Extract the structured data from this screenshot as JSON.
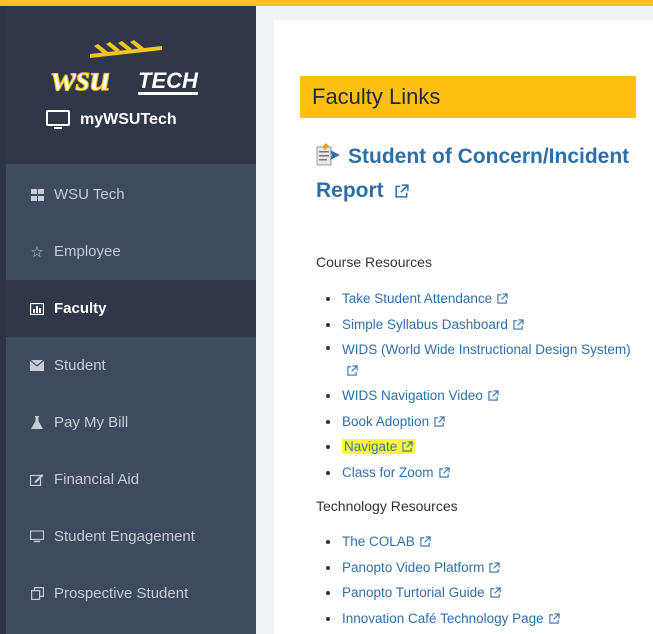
{
  "brand": {
    "logo_text": "wsuTECH",
    "portal_label": "myWSUTech"
  },
  "sidebar": {
    "items": [
      {
        "label": "WSU Tech",
        "icon": "grid-icon"
      },
      {
        "label": "Employee",
        "icon": "star-icon"
      },
      {
        "label": "Faculty",
        "icon": "chart-icon",
        "active": true
      },
      {
        "label": "Student",
        "icon": "envelope-icon"
      },
      {
        "label": "Pay My Bill",
        "icon": "flask-icon"
      },
      {
        "label": "Financial Aid",
        "icon": "edit-icon"
      },
      {
        "label": "Student Engagement",
        "icon": "monitor-icon"
      },
      {
        "label": "Prospective Student",
        "icon": "copy-icon"
      }
    ]
  },
  "main": {
    "section_title": "Faculty Links",
    "report_link": "Student of Concern/Incident Report",
    "course_resources": {
      "title": "Course Resources",
      "links": [
        "Take Student Attendance",
        "Simple Syllabus Dashboard",
        "WIDS (World Wide Instructional Design System)",
        "WIDS Navigation Video",
        "Book Adoption",
        "Navigate",
        "Class for Zoom"
      ]
    },
    "technology_resources": {
      "title": "Technology Resources",
      "links": [
        "The COLAB",
        "Panopto Video Platform",
        "Panopto Turtorial Guide",
        "Innovation Café Technology Page"
      ]
    }
  },
  "colors": {
    "accent": "#fdc010",
    "link": "#2f6fa8",
    "sidebar": "#3f4a5e",
    "sidebar_dark": "#2f3749",
    "highlight": "#ffff33"
  }
}
